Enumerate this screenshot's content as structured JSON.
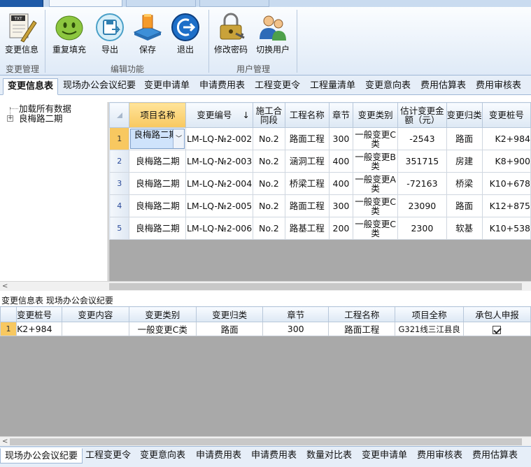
{
  "ribbon": {
    "tabs": [
      "",
      "",
      ""
    ],
    "buttons": {
      "change_info": "变更信息",
      "refill": "重复填充",
      "export": "导出",
      "save": "保存",
      "exit": "退出",
      "change_password": "修改密码",
      "switch_user": "切换用户"
    },
    "groups": {
      "change_mgmt": "变更管理",
      "edit": "编辑功能",
      "user_mgmt": "用户管理"
    }
  },
  "top_tabs": [
    "变更信息表",
    "现场办公会议纪要",
    "变更申请单",
    "申请费用表",
    "工程变更令",
    "工程量清单",
    "变更意向表",
    "费用估算表",
    "费用审核表"
  ],
  "tree": {
    "items": [
      "加载所有数据",
      "良梅路二期"
    ]
  },
  "main_grid": {
    "columns": [
      "项目名称",
      "变更编号",
      "施工合同段",
      "工程名称",
      "章节",
      "变更类别",
      "估计变更金额（元）",
      "变更归类",
      "变更桩号"
    ],
    "sort_indicator": "↓",
    "rows": [
      {
        "no": "1",
        "project": "良梅路二期",
        "code": "LM-LQ-№2-002",
        "section": "No.2",
        "work": "路面工程",
        "chapter": "300",
        "category": "一般变更C类",
        "amount": "-2543",
        "class": "路面",
        "station": "K2+984"
      },
      {
        "no": "2",
        "project": "良梅路二期",
        "code": "LM-LQ-№2-003",
        "section": "No.2",
        "work": "涵洞工程",
        "chapter": "400",
        "category": "一般变更B类",
        "amount": "351715",
        "class": "房建",
        "station": "K8+900"
      },
      {
        "no": "3",
        "project": "良梅路二期",
        "code": "LM-LQ-№2-004",
        "section": "No.2",
        "work": "桥梁工程",
        "chapter": "400",
        "category": "一般变更A类",
        "amount": "-72163",
        "class": "桥梁",
        "station": "K10+678"
      },
      {
        "no": "4",
        "project": "良梅路二期",
        "code": "LM-LQ-№2-005",
        "section": "No.2",
        "work": "路面工程",
        "chapter": "300",
        "category": "一般变更C类",
        "amount": "23090",
        "class": "路面",
        "station": "K12+875"
      },
      {
        "no": "5",
        "project": "良梅路二期",
        "code": "LM-LQ-№2-006",
        "section": "No.2",
        "work": "路基工程",
        "chapter": "200",
        "category": "一般变更C类",
        "amount": "2300",
        "class": "软基",
        "station": "K10+538"
      }
    ]
  },
  "detail_panel": {
    "title": "变更信息表 现场办公会议纪要",
    "columns": [
      "变更桩号",
      "变更内容",
      "变更类别",
      "变更归类",
      "章节",
      "工程名称",
      "项目全称",
      "承包人申报"
    ],
    "rows": [
      {
        "no": "1",
        "station": "K2+984",
        "content": "",
        "category": "一般变更C类",
        "class": "路面",
        "chapter": "300",
        "work": "路面工程",
        "fullname": "G321线三江县良"
      }
    ]
  },
  "bottom_tabs": [
    "现场办公会议纪要",
    "工程变更令",
    "变更意向表",
    "申请费用表",
    "申请费用表",
    "数量对比表",
    "变更申请单",
    "费用审核表",
    "费用估算表"
  ],
  "colors": {
    "ribbon_bg": "#dfeaf7",
    "selected_header": "#f8c860",
    "grid_empty": "#a9a9a9"
  }
}
